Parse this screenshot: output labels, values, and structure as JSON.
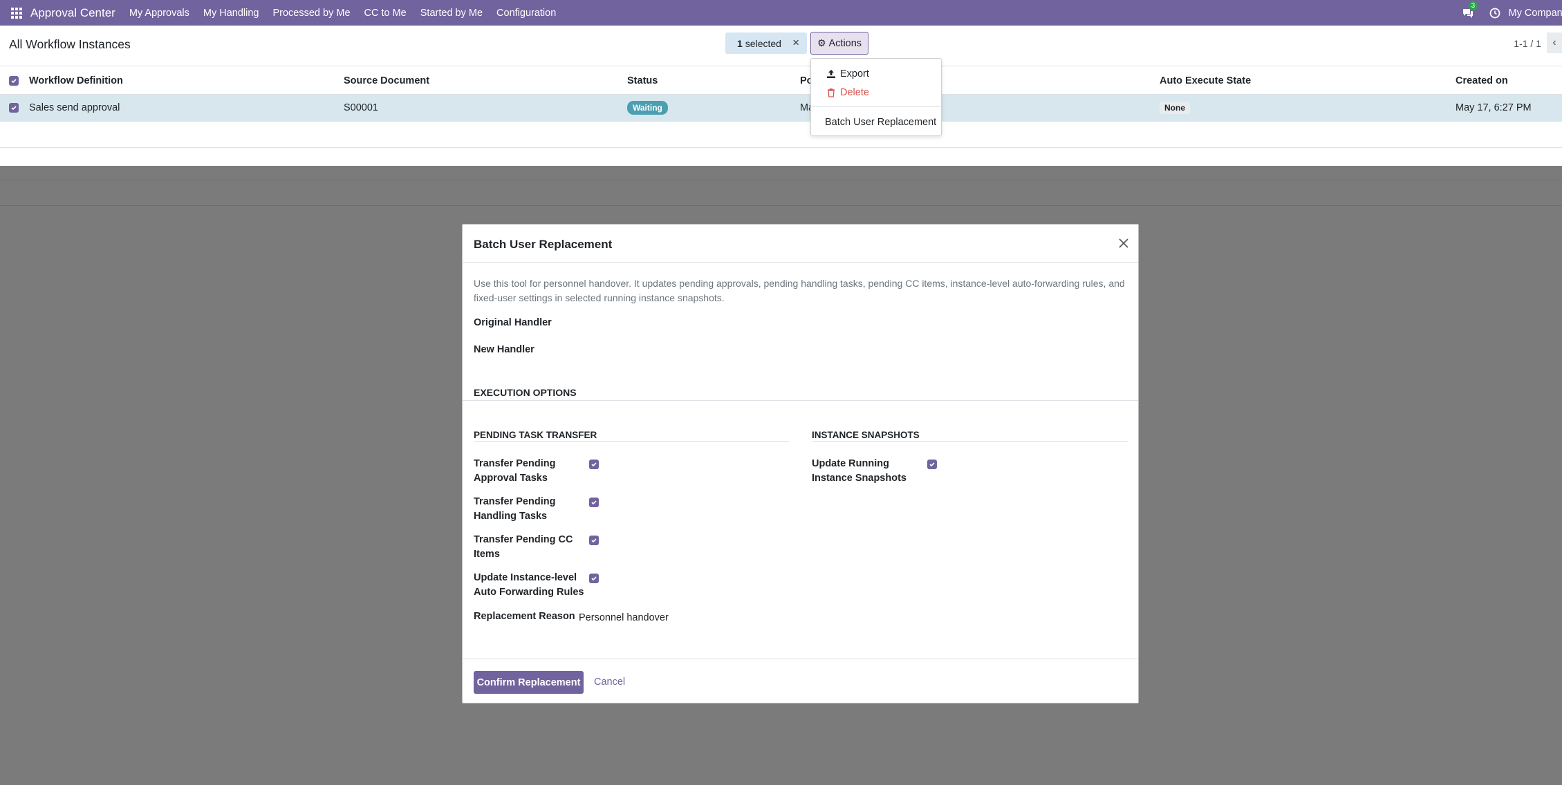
{
  "navbar": {
    "app_name": "Approval Center",
    "menu": [
      "My Approvals",
      "My Handling",
      "Processed by Me",
      "CC to Me",
      "Started by Me",
      "Configuration"
    ],
    "chat_count": "3",
    "company": "My Company"
  },
  "control_panel": {
    "title": "All Workflow Instances",
    "selected_count": "1",
    "selected_label": "selected",
    "clear_symbol": "×",
    "actions_label": "Actions",
    "pager": "1-1 / 1"
  },
  "actions_menu": {
    "export_label": "Export",
    "delete_label": "Delete",
    "batch_label": "Batch User Replacement"
  },
  "list": {
    "columns": {
      "workflow_definition": "Workflow Definition",
      "source_document": "Source Document",
      "status": "Status",
      "po": "Po",
      "auto_execute_state": "Auto Execute State",
      "created_on": "Created on"
    },
    "rows": [
      {
        "workflow_definition": "Sales send approval",
        "source_document": "S00001",
        "status": "Waiting",
        "po_partial": "Ma",
        "auto_execute_state": "None",
        "created_on": "May 17, 6:27 PM"
      }
    ]
  },
  "modal": {
    "title": "Batch User Replacement",
    "description": "Use this tool for personnel handover. It updates pending approvals, pending handling tasks, pending CC items, instance-level auto-forwarding rules, and fixed-user settings in selected running instance snapshots.",
    "original_handler_label": "Original Handler",
    "new_handler_label": "New Handler",
    "section_title": "EXECUTION OPTIONS",
    "group_left_title": "PENDING TASK TRANSFER",
    "group_right_title": "INSTANCE SNAPSHOTS",
    "options_left": [
      {
        "line1": "Transfer Pending",
        "line2": "Approval Tasks",
        "checked": true
      },
      {
        "line1": "Transfer Pending",
        "line2": "Handling Tasks",
        "checked": true
      },
      {
        "line1": "Transfer Pending CC",
        "line2": "Items",
        "checked": true
      },
      {
        "line1": "Update Instance-level",
        "line2": "Auto Forwarding Rules",
        "checked": true
      }
    ],
    "options_right": [
      {
        "line1": "Update Running",
        "line2": "Instance Snapshots",
        "checked": true
      }
    ],
    "reason_label": "Replacement Reason",
    "reason_value": "Personnel handover",
    "confirm_label": "Confirm Replacement",
    "cancel_label": "Cancel"
  },
  "colors": {
    "brand": "#71639e",
    "overlay": "#7b7b7b",
    "selected_row": "#d8e7ee",
    "waiting_badge": "#4b9fb0",
    "delete": "#d9534f"
  }
}
